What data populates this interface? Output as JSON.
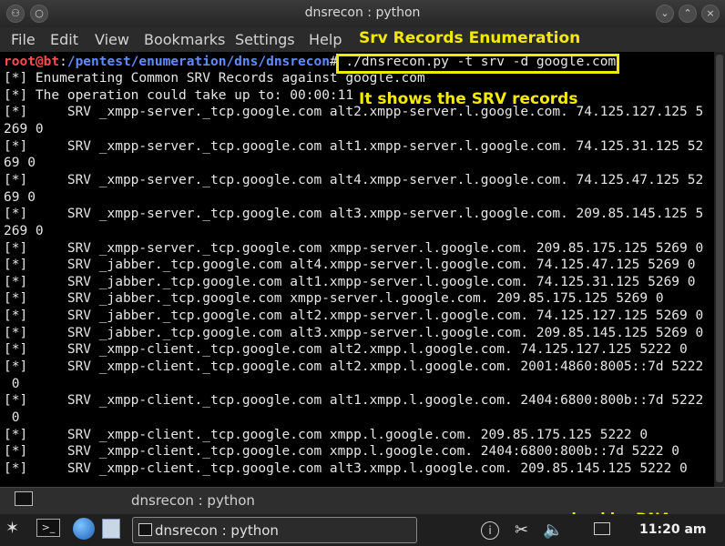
{
  "window": {
    "title": "dnsrecon : python"
  },
  "menu": {
    "items": [
      "File",
      "Edit",
      "View",
      "Bookmarks",
      "Settings",
      "Help"
    ]
  },
  "annotations": {
    "top": "Srv Records Enumeration",
    "middle": "It shows the SRV records"
  },
  "terminal": {
    "prompt_user": "root@bt",
    "prompt_sep": ":",
    "prompt_path": "/pentest/enumeration/dns/dnsrecon",
    "prompt_hash": "#",
    "command": " ./dnsrecon.py -t srv -d google.com",
    "lines": [
      "[*] Enumerating Common SRV Records against google.com",
      "[*] The operation could take up to: 00:00:11",
      "[*]     SRV _xmpp-server._tcp.google.com alt2.xmpp-server.l.google.com. 74.125.127.125 5",
      "269 0",
      "[*]     SRV _xmpp-server._tcp.google.com alt1.xmpp-server.l.google.com. 74.125.31.125 52",
      "69 0",
      "[*]     SRV _xmpp-server._tcp.google.com alt4.xmpp-server.l.google.com. 74.125.47.125 52",
      "69 0",
      "[*]     SRV _xmpp-server._tcp.google.com alt3.xmpp-server.l.google.com. 209.85.145.125 5",
      "269 0",
      "[*]     SRV _xmpp-server._tcp.google.com xmpp-server.l.google.com. 209.85.175.125 5269 0",
      "[*]     SRV _jabber._tcp.google.com alt4.xmpp-server.l.google.com. 74.125.47.125 5269 0",
      "[*]     SRV _jabber._tcp.google.com alt1.xmpp-server.l.google.com. 74.125.31.125 5269 0",
      "[*]     SRV _jabber._tcp.google.com xmpp-server.l.google.com. 209.85.175.125 5269 0",
      "[*]     SRV _jabber._tcp.google.com alt2.xmpp-server.l.google.com. 74.125.127.125 5269 0",
      "[*]     SRV _jabber._tcp.google.com alt3.xmpp-server.l.google.com. 209.85.145.125 5269 0",
      "[*]     SRV _xmpp-client._tcp.google.com alt2.xmpp.l.google.com. 74.125.127.125 5222 0",
      "[*]     SRV _xmpp-client._tcp.google.com alt2.xmpp.l.google.com. 2001:4860:8005::7d 5222",
      " 0",
      "[*]     SRV _xmpp-client._tcp.google.com alt1.xmpp.l.google.com. 2404:6800:800b::7d 5222",
      " 0",
      "[*]     SRV _xmpp-client._tcp.google.com xmpp.l.google.com. 209.85.175.125 5222 0",
      "[*]     SRV _xmpp-client._tcp.google.com xmpp.l.google.com. 2404:6800:800b::7d 5222 0",
      "[*]     SRV _xmpp-client._tcp.google.com alt3.xmpp.l.google.com. 209.85.145.125 5222 0"
    ]
  },
  "tab": {
    "label": "dnsrecon : python"
  },
  "watermark": "www.hackingDNA.com",
  "taskbar": {
    "task_label": "dnsrecon : python",
    "clock": "11:20 am"
  },
  "icons": {
    "window_menu": "window-menu-icon",
    "minimize": "minimize-icon",
    "maximize": "maximize-icon",
    "close": "close-icon"
  }
}
